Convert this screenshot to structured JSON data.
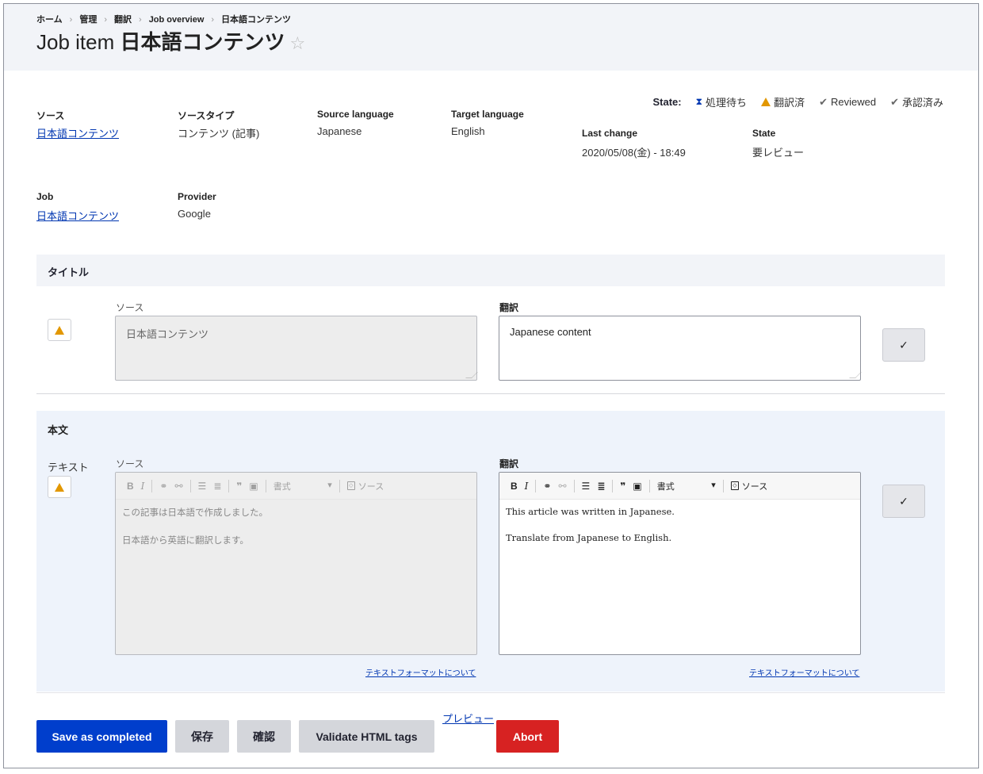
{
  "breadcrumb": [
    "ホーム",
    "管理",
    "翻訳",
    "Job overview",
    "日本語コンテンツ"
  ],
  "title": {
    "prefix": "Job item",
    "name": "日本語コンテンツ",
    "star": "☆"
  },
  "info": {
    "source_label": "ソース",
    "source_value": "日本語コンテンツ",
    "source_type_label": "ソースタイプ",
    "source_type_value": "コンテンツ (記事)",
    "source_language_label": "Source language",
    "source_language_value": "Japanese",
    "target_language_label": "Target language",
    "target_language_value": "English",
    "job_label": "Job",
    "job_value": "日本語コンテンツ",
    "provider_label": "Provider",
    "provider_value": "Google",
    "last_change_label": "Last change",
    "last_change_value": "2020/05/08(金) - 18:49",
    "state_label": "State",
    "state_value": "要レビュー"
  },
  "state_legend": {
    "label": "State:",
    "items": [
      "処理待ち",
      "翻訳済",
      "Reviewed",
      "承認済み"
    ]
  },
  "title_section": {
    "heading": "タイトル",
    "source_label": "ソース",
    "translation_label": "翻訳",
    "source_text": "日本語コンテンツ",
    "translation_text": "Japanese content"
  },
  "body_section": {
    "heading": "本文",
    "field_label": "テキスト",
    "source_label": "ソース",
    "translation_label": "翻訳",
    "toolbar": {
      "bold": "B",
      "italic": "I",
      "format": "書式",
      "source": "ソース"
    },
    "source_lines": [
      "この記事は日本語で作成しました。",
      "日本語から英語に翻訳します。"
    ],
    "translation_lines": [
      "This article was written in Japanese.",
      "Translate from Japanese to English."
    ],
    "format_help_link": "テキストフォーマットについて"
  },
  "actions": {
    "save_completed": "Save as completed",
    "save": "保存",
    "confirm": "確認",
    "validate": "Validate HTML tags",
    "preview": "プレビュー",
    "abort": "Abort"
  },
  "colors": {
    "primary": "#003ecc",
    "danger": "#d72222",
    "link": "#0036b1",
    "warning": "#e29700"
  }
}
